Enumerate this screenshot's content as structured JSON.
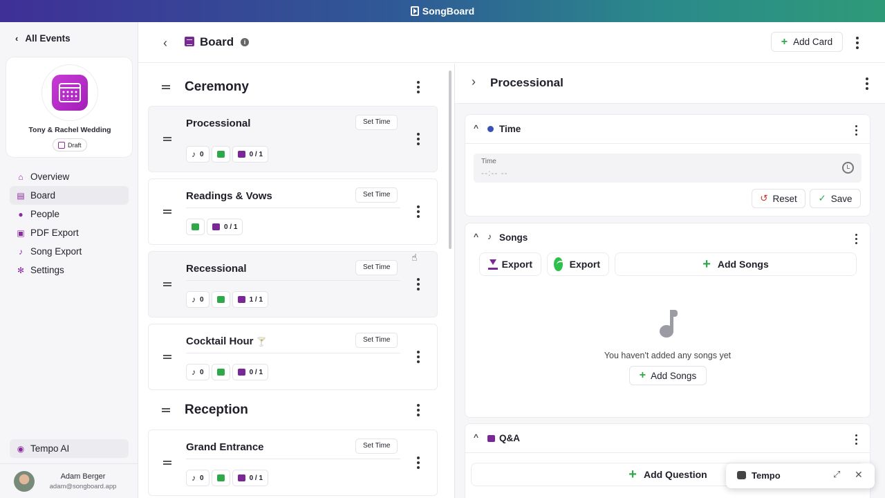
{
  "app": {
    "name": "SongBoard"
  },
  "sidebar": {
    "back_label": "All Events",
    "event": {
      "name": "Tony & Rachel Wedding",
      "status": "Draft"
    },
    "nav": [
      {
        "label": "Overview",
        "icon": "home-icon"
      },
      {
        "label": "Board",
        "icon": "board-icon"
      },
      {
        "label": "People",
        "icon": "people-icon"
      },
      {
        "label": "PDF Export",
        "icon": "print-icon"
      },
      {
        "label": "Song Export",
        "icon": "music-note-icon"
      },
      {
        "label": "Settings",
        "icon": "gear-icon"
      }
    ],
    "tempo_ai": "Tempo AI",
    "user": {
      "name": "Adam Berger",
      "email": "adam@songboard.app"
    }
  },
  "header": {
    "title": "Board",
    "add_card": "Add Card"
  },
  "board": {
    "sections": [
      {
        "title": "Ceremony"
      },
      {
        "title": "Reception"
      }
    ],
    "set_time_label": "Set Time",
    "cards": [
      {
        "title": "Processional",
        "songs": "0",
        "qa": "0 / 1",
        "selected": true
      },
      {
        "title": "Readings & Vows",
        "qa": "0 / 1"
      },
      {
        "title": "Recessional",
        "songs": "0",
        "qa": "1 / 1"
      },
      {
        "title": "Cocktail Hour",
        "emoji": "🍸",
        "songs": "0",
        "qa": "0 / 1"
      },
      {
        "title": "Grand Entrance",
        "songs": "0",
        "qa": "0 / 1"
      }
    ]
  },
  "detail": {
    "title": "Processional",
    "time": {
      "title": "Time",
      "field_label": "Time",
      "field_value": "--:-- --",
      "reset": "Reset",
      "save": "Save"
    },
    "songs": {
      "title": "Songs",
      "export_download": "Export",
      "export_spotify": "Export",
      "add_songs": "Add Songs",
      "empty": "You haven't added any songs yet",
      "add_songs_small": "Add Songs"
    },
    "qa": {
      "title": "Q&A",
      "add_question": "Add Question"
    }
  },
  "tempo_popup": {
    "name": "Tempo"
  },
  "colors": {
    "accent": "#7a2896",
    "green": "#2fa84a",
    "blue": "#3a52b8"
  }
}
